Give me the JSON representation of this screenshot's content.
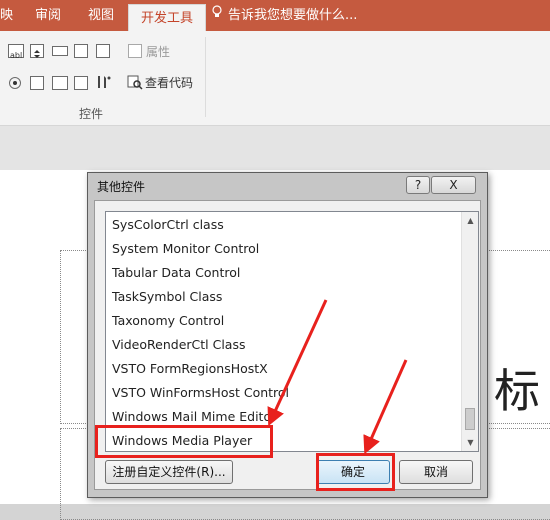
{
  "ribbon": {
    "tabs": [
      {
        "label": "映",
        "active": false
      },
      {
        "label": "审阅",
        "active": false
      },
      {
        "label": "视图",
        "active": false
      },
      {
        "label": "开发工具",
        "active": true
      }
    ],
    "tell_me": "告诉我您想要做什么...",
    "controls": {
      "properties_label": "属性",
      "view_code_label": "查看代码",
      "group_label": "控件"
    }
  },
  "slide": {
    "title_fragment": "标"
  },
  "dialog": {
    "title": "其他控件",
    "help_label": "?",
    "close_label": "X",
    "items": [
      "SysColorCtrl class",
      "System Monitor Control",
      "Tabular Data Control",
      "TaskSymbol Class",
      "Taxonomy Control",
      "VideoRenderCtl Class",
      "VSTO FormRegionsHostX",
      "VSTO WinFormsHost Control",
      "Windows Mail Mime Editor",
      "Windows Media Player"
    ],
    "selected_item": "Windows Media Player",
    "register_label": "注册自定义控件(R)...",
    "ok_label": "确定",
    "cancel_label": "取消"
  },
  "colors": {
    "accent": "#c55a3f",
    "highlight": "#e8211d"
  }
}
